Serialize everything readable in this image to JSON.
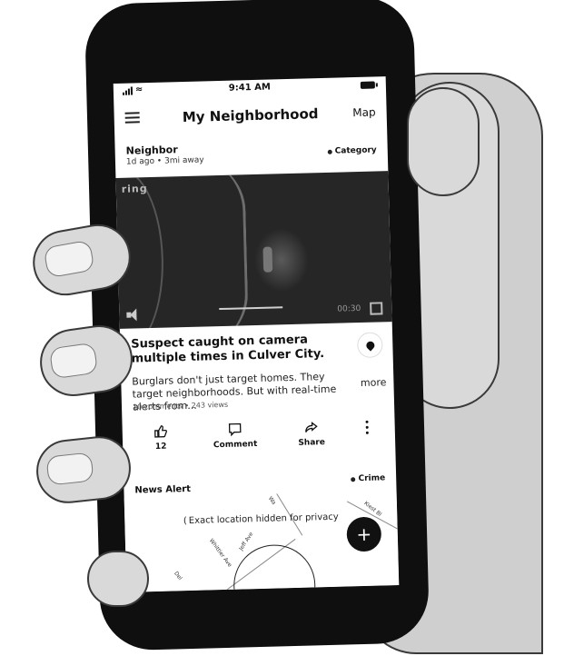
{
  "status_bar": {
    "time": "9:41 AM"
  },
  "header": {
    "title": "My Neighborhood",
    "map_link": "Map"
  },
  "post": {
    "author": "Neighbor",
    "meta": "1d ago • 3mi away",
    "category": "Category",
    "video": {
      "logo": "ring",
      "timestamp": "00:30"
    },
    "headline": "Suspect caught on camera multiple times in Culver City.",
    "excerpt": "Burglars don't just target homes. They target neighborhoods. But with real-time alerts from...",
    "more_label": "more",
    "stats": "10 comments • 243 views",
    "actions": {
      "like_count": "12",
      "comment_label": "Comment",
      "share_label": "Share"
    }
  },
  "alert": {
    "type": "News Alert",
    "tag": "Crime",
    "privacy_note": "Exact location hidden for privacy",
    "streets": [
      "Whittier Ave",
      "Jeff Ave",
      "Del",
      "Kiest Bl",
      "Wa"
    ]
  },
  "fab_label": "+",
  "colors": {
    "screen_bg": "#ffffff",
    "phone_body": "#0f0f0f",
    "fab": "#111111",
    "video_bg": "#262626"
  }
}
